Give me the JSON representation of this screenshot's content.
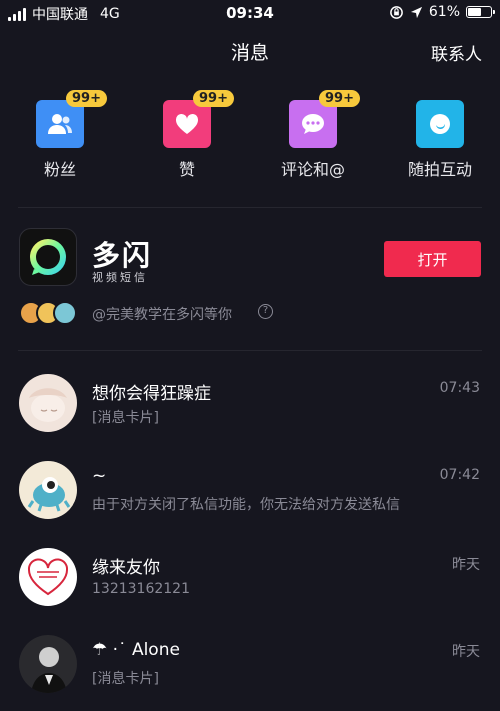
{
  "status_bar": {
    "carrier": "中国联通",
    "network": "4G",
    "time": "09:34",
    "battery": "61%",
    "battery_level": 0.61
  },
  "header": {
    "title": "消息",
    "contacts_label": "联系人"
  },
  "categories": [
    {
      "label": "粉丝",
      "badge": "99+",
      "icon": "fans-icon",
      "color": "#3f8ff5"
    },
    {
      "label": "赞",
      "badge": "99+",
      "icon": "heart-icon",
      "color": "#f23d7c"
    },
    {
      "label": "评论和@",
      "badge": "99+",
      "icon": "comment-icon",
      "color": "#c86ff0"
    },
    {
      "label": "随拍互动",
      "badge": "",
      "icon": "moon-icon",
      "color": "#22b4e8"
    }
  ],
  "promo": {
    "app_name": "多闪",
    "app_subtitle": "视频短信",
    "open_label": "打开",
    "text": "@完美教学在多闪等你",
    "logo_icon": "duoshan-logo-icon"
  },
  "messages": [
    {
      "name": "想你会得狂躁症",
      "preview": "[消息卡片]",
      "time": "07:43"
    },
    {
      "name": "~",
      "preview": "由于对方关闭了私信功能，你无法给对方发送私信",
      "time": "07:42"
    },
    {
      "name": "缘来友你",
      "preview": "13213162121",
      "time": "昨天"
    },
    {
      "name": "☂ ·˙  Alone",
      "preview": "[消息卡片]",
      "time": "昨天"
    }
  ],
  "colors": {
    "background": "#16161f",
    "accent": "#f02a4e",
    "badge": "#f7c93c",
    "secondary_text": "#8a8a96"
  }
}
